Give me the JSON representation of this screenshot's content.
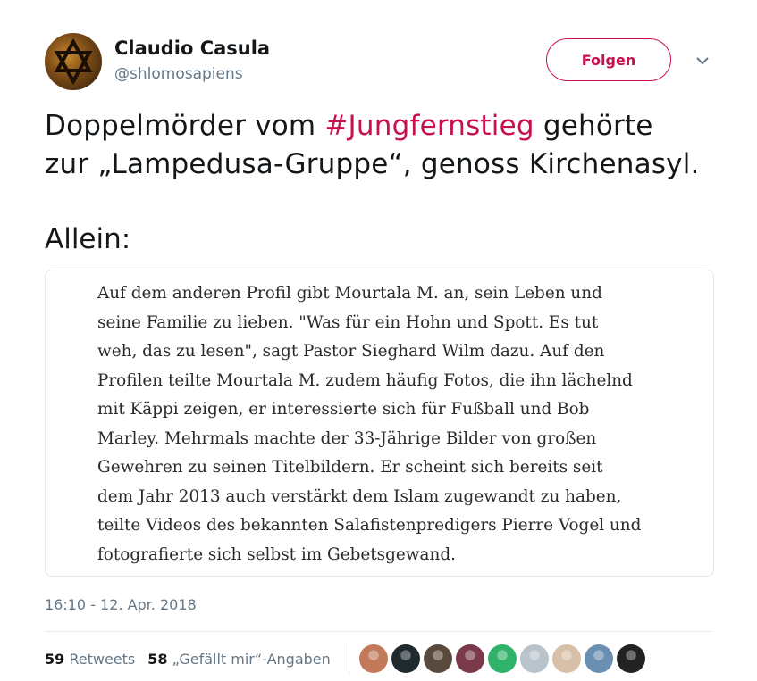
{
  "user": {
    "name": "Claudio Casula",
    "handle": "@shlomosapiens"
  },
  "follow_button": {
    "label": "Folgen"
  },
  "tweet": {
    "line1_before": "Doppelmörder vom ",
    "hashtag": "#Jungfernstieg",
    "line1_after": " gehörte",
    "line2": "zur „Lampedusa-Gruppe“, genoss Kirchenasyl.",
    "line3": "Allein:"
  },
  "quote": {
    "lines": [
      "Auf dem anderen Profil gibt Mourtala M. an, sein Leben und",
      "seine Familie zu lieben. \"Was für ein Hohn und Spott. Es tut",
      "weh, das zu lesen\", sagt Pastor Sieghard Wilm dazu. Auf den",
      "Profilen teilte Mourtala M. zudem häufig Fotos, die ihn lächelnd",
      "mit Käppi zeigen, er interessierte sich für Fußball und Bob",
      "Marley. Mehrmals machte der 33-Jährige Bilder von großen",
      "Gewehren zu seinen Titelbildern. Er scheint sich bereits seit",
      "dem Jahr 2013 auch verstärkt dem Islam zugewandt zu haben,",
      "teilte Videos des bekannten Salafistenpredigers Pierre Vogel und",
      "fotografierte sich selbst im Gebetsgewand."
    ]
  },
  "timestamp": "16:10 - 12. Apr. 2018",
  "stats": {
    "retweets_count": "59",
    "retweets_label": "Retweets",
    "likes_count": "58",
    "likes_label": "„Gefällt mir“-Angaben"
  },
  "likers": [
    {
      "icon": "avatar-man-glasses",
      "color": "#c27a5a"
    },
    {
      "icon": "avatar-dark-bird",
      "color": "#1e2a2e"
    },
    {
      "icon": "avatar-man-dark",
      "color": "#5a4a3e"
    },
    {
      "icon": "avatar-couple",
      "color": "#7a3a4a"
    },
    {
      "icon": "avatar-green-circle",
      "color": "#2fb36a"
    },
    {
      "icon": "avatar-default-egg",
      "color": "#b8c3cc"
    },
    {
      "icon": "avatar-man-beige",
      "color": "#d8c0a8"
    },
    {
      "icon": "avatar-man-blue",
      "color": "#6a8fb0"
    },
    {
      "icon": "avatar-dark-silhouette",
      "color": "#222222"
    }
  ],
  "colors": {
    "accent": "#c8104f",
    "muted": "#657786",
    "text": "#14171a",
    "border": "#e1e8ed"
  }
}
